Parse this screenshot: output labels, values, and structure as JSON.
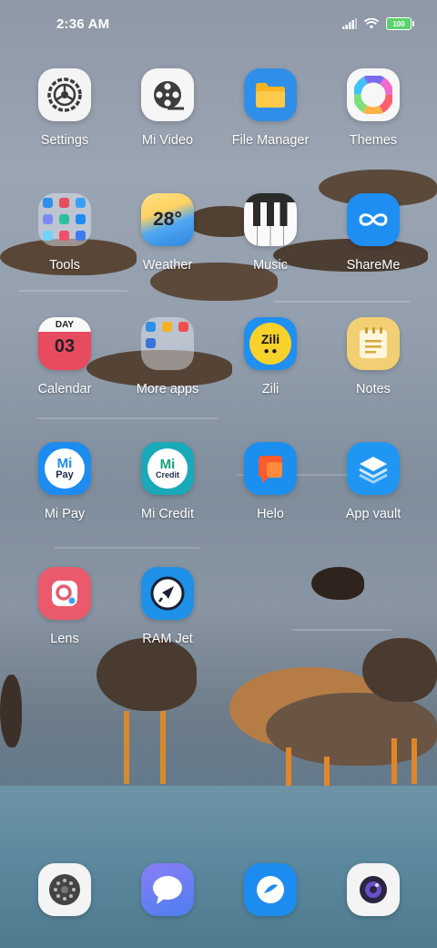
{
  "status_bar": {
    "time": "2:36 AM",
    "battery": "100",
    "icons": [
      "signal-icon",
      "wifi-icon",
      "battery-icon"
    ]
  },
  "apps": [
    {
      "label": "Settings",
      "icon": "settings-gear-icon"
    },
    {
      "label": "Mi Video",
      "icon": "film-reel-icon"
    },
    {
      "label": "File Manager",
      "icon": "folder-icon"
    },
    {
      "label": "Themes",
      "icon": "color-wheel-icon"
    },
    {
      "label": "Tools",
      "icon": "tools-folder-icon"
    },
    {
      "label": "Weather",
      "icon": "weather-sun-icon",
      "text": "28°"
    },
    {
      "label": "Music",
      "icon": "piano-keys-icon"
    },
    {
      "label": "ShareMe",
      "icon": "infinity-share-icon"
    },
    {
      "label": "Calendar",
      "icon": "calendar-icon",
      "day_label": "DAY",
      "day_number": "03"
    },
    {
      "label": "More apps",
      "icon": "more-apps-folder-icon"
    },
    {
      "label": "Zili",
      "icon": "zili-icon",
      "text": "Zili"
    },
    {
      "label": "Notes",
      "icon": "notes-icon"
    },
    {
      "label": "Mi Pay",
      "icon": "mi-pay-icon",
      "text_top": "Mi",
      "text_bottom": "Pay"
    },
    {
      "label": "Mi Credit",
      "icon": "mi-credit-icon",
      "text_top": "Mi",
      "text_bottom": "Credit"
    },
    {
      "label": "Helo",
      "icon": "helo-chat-icon"
    },
    {
      "label": "App vault",
      "icon": "app-vault-layers-icon"
    },
    {
      "label": "Lens",
      "icon": "lens-icon"
    },
    {
      "label": "RAM Jet",
      "icon": "rocket-icon"
    }
  ],
  "dock": [
    {
      "icon": "phone-dialer-icon"
    },
    {
      "icon": "messaging-icon"
    },
    {
      "icon": "browser-icon"
    },
    {
      "icon": "camera-icon"
    }
  ],
  "colors": {
    "label_text": "#ffffff",
    "settings_bg": "#f4f4f4",
    "file_manager_bg": "#2f8fe8",
    "shareme_bg": "#1e8ef2",
    "calendar_bg": "#e84a5f",
    "notes_bg": "#f2cf72",
    "zili_bg": "#f6d22a",
    "mi_pay_bg": "#1d8cf0",
    "mi_credit_bg": "#1aa9b8",
    "helo_bg": "#1a8ff0",
    "app_vault_bg": "#1f97f2",
    "lens_bg": "#ea5a6c",
    "ram_jet_bg": "#1f91e8"
  }
}
